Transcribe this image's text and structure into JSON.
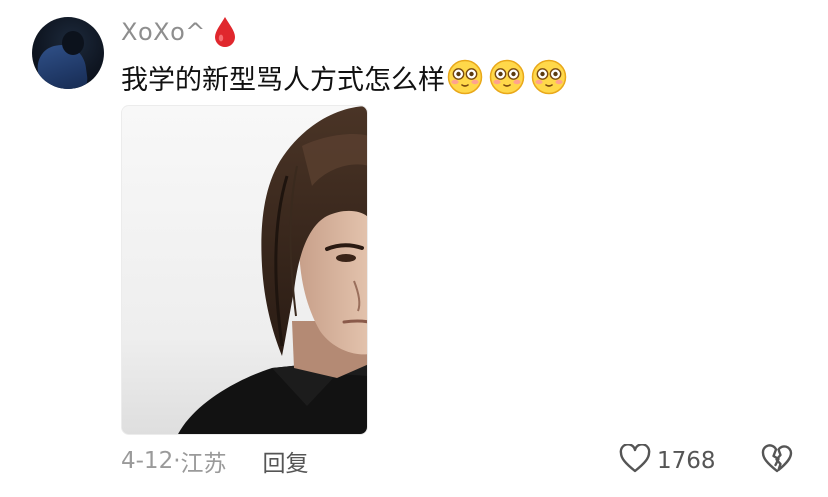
{
  "comment": {
    "author": {
      "username": "XoXo^",
      "badge_icon": "blood-drop-icon",
      "badge_color": "#e0272d"
    },
    "text": "我学的新型骂人方式怎么样",
    "emojis": [
      "flushed-face-icon",
      "flushed-face-icon",
      "flushed-face-icon"
    ],
    "footer": {
      "date": "4-12",
      "separator": "·",
      "location": "江苏",
      "reply_label": "回复",
      "like_count": "1768",
      "like_icon": "heart-outline-icon",
      "dislike_icon": "broken-heart-icon"
    }
  },
  "colors": {
    "username": "#8e8e8e",
    "text": "#111111",
    "meta": "#9a9a9a",
    "action": "#555555"
  }
}
